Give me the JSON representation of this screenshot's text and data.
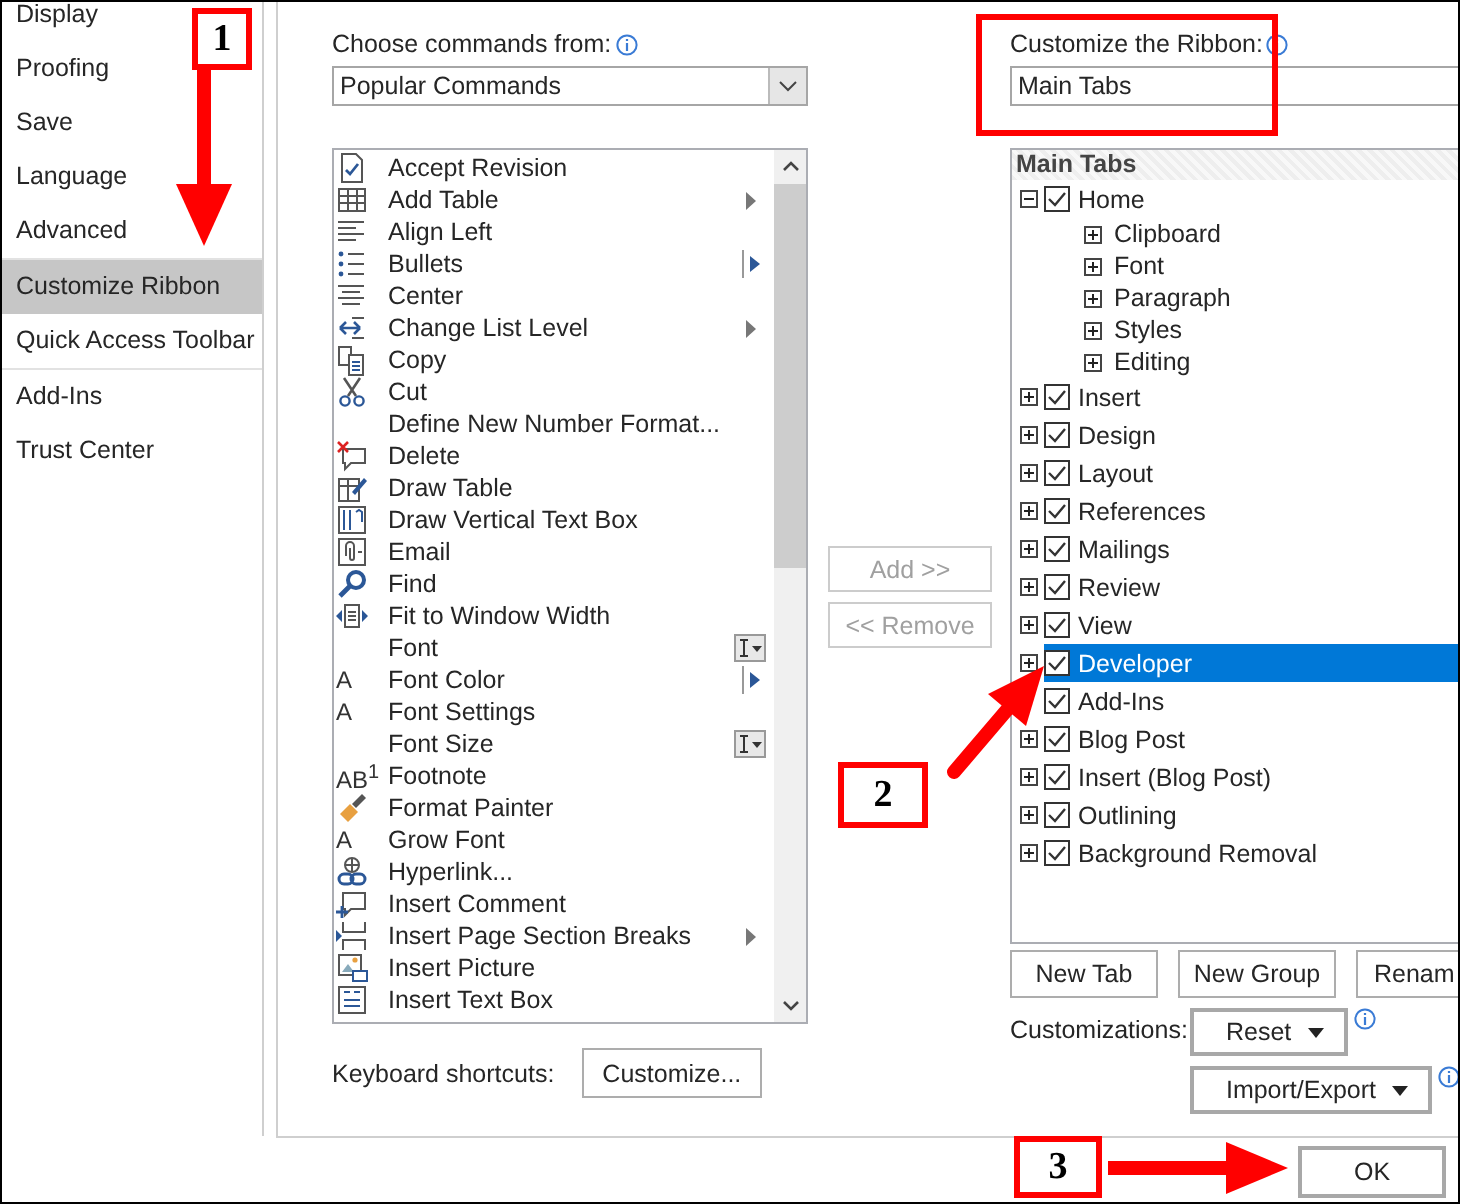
{
  "sidebar": {
    "groups": [
      [
        {
          "label": "Display",
          "selected": false
        },
        {
          "label": "Proofing",
          "selected": false
        },
        {
          "label": "Save",
          "selected": false
        },
        {
          "label": "Language",
          "selected": false
        },
        {
          "label": "Advanced",
          "selected": false
        }
      ],
      [
        {
          "label": "Customize Ribbon",
          "selected": true
        },
        {
          "label": "Quick Access Toolbar",
          "selected": false
        }
      ],
      [
        {
          "label": "Add-Ins",
          "selected": false
        },
        {
          "label": "Trust Center",
          "selected": false
        }
      ]
    ]
  },
  "commands": {
    "label": "Choose commands from:",
    "value": "Popular Commands",
    "items": [
      {
        "label": "Accept Revision",
        "kind": "plain"
      },
      {
        "label": "Add Table",
        "kind": "submenu"
      },
      {
        "label": "Align Left",
        "kind": "plain"
      },
      {
        "label": "Bullets",
        "kind": "split"
      },
      {
        "label": "Center",
        "kind": "plain"
      },
      {
        "label": "Change List Level",
        "kind": "submenu"
      },
      {
        "label": "Copy",
        "kind": "plain"
      },
      {
        "label": "Cut",
        "kind": "plain"
      },
      {
        "label": "Define New Number Format...",
        "kind": "plain"
      },
      {
        "label": "Delete",
        "kind": "plain"
      },
      {
        "label": "Draw Table",
        "kind": "plain"
      },
      {
        "label": "Draw Vertical Text Box",
        "kind": "plain"
      },
      {
        "label": "Email",
        "kind": "plain"
      },
      {
        "label": "Find",
        "kind": "plain"
      },
      {
        "label": "Fit to Window Width",
        "kind": "plain"
      },
      {
        "label": "Font",
        "kind": "combo"
      },
      {
        "label": "Font Color",
        "kind": "split",
        "glyph": "A"
      },
      {
        "label": "Font Settings",
        "kind": "plain",
        "glyph": "A"
      },
      {
        "label": "Font Size",
        "kind": "combo"
      },
      {
        "label": "Footnote",
        "kind": "plain",
        "glyph": "AB$^{1}$"
      },
      {
        "label": "Format Painter",
        "kind": "plain"
      },
      {
        "label": "Grow Font",
        "kind": "plain",
        "glyph": "A"
      },
      {
        "label": "Hyperlink...",
        "kind": "plain"
      },
      {
        "label": "Insert Comment",
        "kind": "plain"
      },
      {
        "label": "Insert Page  Section Breaks",
        "kind": "submenu"
      },
      {
        "label": "Insert Picture",
        "kind": "plain"
      },
      {
        "label": "Insert Text Box",
        "kind": "plain"
      }
    ]
  },
  "keyboard_shortcuts": {
    "label": "Keyboard shortcuts:",
    "button": "Customize..."
  },
  "transfer_buttons": [
    {
      "label": "Add >>",
      "disabled": true
    },
    {
      "label": "<< Remove",
      "disabled": true
    }
  ],
  "ribbon": {
    "label": "Customize the Ribbon:",
    "value": "Main Tabs",
    "tree_header": "Main Tabs",
    "tree": [
      {
        "label": "Home",
        "checked": true,
        "expandable": true,
        "expanded": true,
        "selected": false,
        "children": [
          {
            "label": "Clipboard",
            "expanded": false
          },
          {
            "label": "Font",
            "expanded": false
          },
          {
            "label": "Paragraph",
            "expanded": false
          },
          {
            "label": "Styles",
            "expanded": false
          },
          {
            "label": "Editing",
            "expanded": false
          }
        ]
      },
      {
        "label": "Insert",
        "checked": true,
        "expandable": true,
        "expanded": false,
        "selected": false
      },
      {
        "label": "Design",
        "checked": true,
        "expandable": true,
        "expanded": false,
        "selected": false
      },
      {
        "label": "Layout",
        "checked": true,
        "expandable": true,
        "expanded": false,
        "selected": false
      },
      {
        "label": "References",
        "checked": true,
        "expandable": true,
        "expanded": false,
        "selected": false
      },
      {
        "label": "Mailings",
        "checked": true,
        "expandable": true,
        "expanded": false,
        "selected": false
      },
      {
        "label": "Review",
        "checked": true,
        "expandable": true,
        "expanded": false,
        "selected": false
      },
      {
        "label": "View",
        "checked": true,
        "expandable": true,
        "expanded": false,
        "selected": false
      },
      {
        "label": "Developer",
        "checked": true,
        "expandable": true,
        "expanded": false,
        "selected": true
      },
      {
        "label": "Add-Ins",
        "checked": true,
        "expandable": false,
        "selected": false
      },
      {
        "label": "Blog Post",
        "checked": true,
        "expandable": true,
        "expanded": false,
        "selected": false
      },
      {
        "label": "Insert (Blog Post)",
        "checked": true,
        "expandable": true,
        "expanded": false,
        "selected": false
      },
      {
        "label": "Outlining",
        "checked": true,
        "expandable": true,
        "expanded": false,
        "selected": false
      },
      {
        "label": "Background Removal",
        "checked": true,
        "expandable": true,
        "expanded": false,
        "selected": false
      }
    ]
  },
  "ribbon_buttons": [
    "New Tab",
    "New Group",
    "Renam"
  ],
  "customizations": {
    "label": "Customizations:",
    "buttons": [
      "Reset",
      "Import/Export"
    ]
  },
  "ok_button": "OK",
  "annotations": [
    {
      "label": "1"
    },
    {
      "label": "2"
    },
    {
      "label": "3"
    }
  ]
}
